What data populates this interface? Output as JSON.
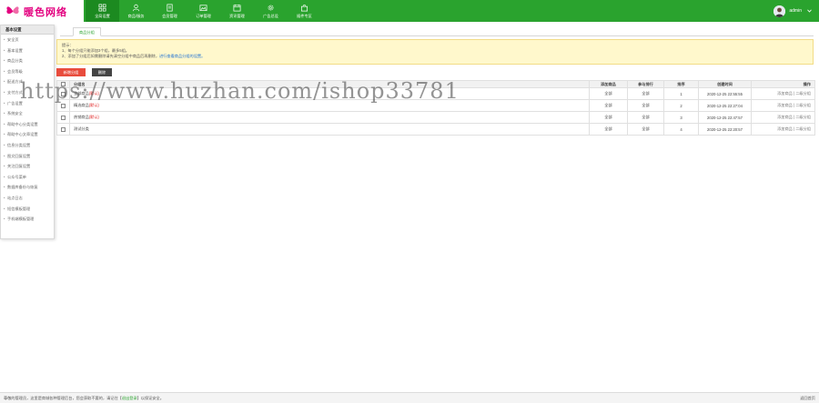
{
  "brand": {
    "logo_text": "暖色网络"
  },
  "nav": [
    {
      "label": "全局设置",
      "icon": "grid-icon",
      "active": true
    },
    {
      "label": "商品/服务",
      "icon": "user-icon"
    },
    {
      "label": "会员管理",
      "icon": "document-icon"
    },
    {
      "label": "订单管理",
      "icon": "image-icon"
    },
    {
      "label": "资讯管理",
      "icon": "calendar-icon"
    },
    {
      "label": "广告总设",
      "icon": "gear-icon"
    },
    {
      "label": "插件专区",
      "icon": "bag-icon"
    }
  ],
  "user": {
    "name": "admin"
  },
  "sidebar": {
    "title": "基本设置",
    "items": [
      {
        "label": "安全页"
      },
      {
        "label": "基本设置"
      },
      {
        "label": "商品分类"
      },
      {
        "label": "会员等级"
      },
      {
        "label": "配送方式"
      },
      {
        "label": "支付方式"
      },
      {
        "label": "广告设置"
      },
      {
        "label": "系统安全"
      },
      {
        "label": "帮助中心分类设置"
      },
      {
        "label": "帮助中心文章设置"
      },
      {
        "label": "信息分类设置"
      },
      {
        "label": "图文回复设置"
      },
      {
        "label": "关注回复设置"
      },
      {
        "label": "公众号菜单"
      },
      {
        "label": "数据库备份与恢复"
      },
      {
        "label": "站点日志"
      },
      {
        "label": "短信模板管理"
      },
      {
        "label": "手机端模板管理"
      }
    ]
  },
  "tabs": {
    "active": "商品分组"
  },
  "notice": {
    "title": "提示：",
    "line1": "1、每个分组只能添加3个组，最多5组。",
    "line2_prefix": "2、添加了分组后如需删除请先清空分组中商品后再删除，",
    "line2_link": "进行查看商品分组的设置。"
  },
  "toolbar": {
    "add_label": "新增分组",
    "delete_label": "删除"
  },
  "table": {
    "columns": [
      "分组名",
      "添加商品",
      "参与排行",
      "排序",
      "创建时间",
      "操作"
    ],
    "rows": [
      {
        "name": "全部商品",
        "default": true,
        "default_label": "(默认)",
        "add": "全部",
        "rank": "全部",
        "order": "1",
        "time": "2020-12-25 22:55:55",
        "ops": "添加商品 | 二级分组"
      },
      {
        "name": "精选商品",
        "default": true,
        "default_label": "(默认)",
        "add": "全部",
        "rank": "全部",
        "order": "2",
        "time": "2020-12-25 22:27:04",
        "ops": "添加商品 | 二级分组"
      },
      {
        "name": "热销商品",
        "default": true,
        "default_label": "(默认)",
        "add": "全部",
        "rank": "全部",
        "order": "3",
        "time": "2020-12-25 22:47:57",
        "ops": "添加商品 | 二级分组"
      },
      {
        "name": "测试分类",
        "default": false,
        "default_label": "",
        "add": "全部",
        "rank": "全部",
        "order": "4",
        "time": "2020-12-25 22:20:57",
        "ops": "添加商品 | 二级分组"
      }
    ]
  },
  "watermark": "https://www.huzhan.com/ishop33781",
  "footer": {
    "text_before": "尊敬的管理员，这里是商城各种管理后台，您会获取不要的，请记住【",
    "link": "退出登录",
    "text_after": "】以保证安全。",
    "back": "返回首页"
  },
  "colors": {
    "primary": "#2aa32e",
    "danger": "#e84c3d",
    "notice_bg": "#fff8cc"
  }
}
